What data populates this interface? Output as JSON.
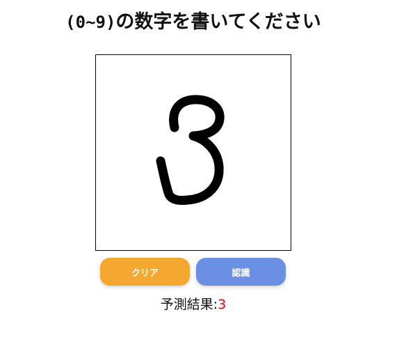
{
  "page": {
    "title_prefix": "(0~9)",
    "title_text": "の数字を書いてください"
  },
  "canvas": {
    "stroke_color": "#000000",
    "background": "#ffffff"
  },
  "buttons": {
    "clear_label": "クリア",
    "clear_color": "#f5a830",
    "recognize_label": "認識",
    "recognize_color": "#6b8fe3"
  },
  "result": {
    "label": "予測結果:",
    "value": "3",
    "value_color": "#ff0000"
  }
}
